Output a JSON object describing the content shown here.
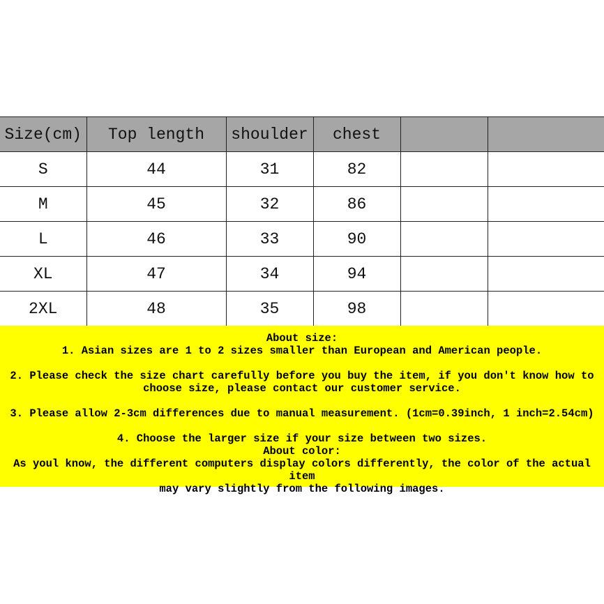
{
  "table": {
    "headers": [
      "Size(cm)",
      "Top length",
      "shoulder",
      "chest",
      "",
      ""
    ],
    "rows": [
      [
        "S",
        "44",
        "31",
        "82",
        "",
        ""
      ],
      [
        "M",
        "45",
        "32",
        "86",
        "",
        ""
      ],
      [
        "L",
        "46",
        "33",
        "90",
        "",
        ""
      ],
      [
        "XL",
        "47",
        "34",
        "94",
        "",
        ""
      ],
      [
        "2XL",
        "48",
        "35",
        "98",
        "",
        ""
      ]
    ]
  },
  "notes": {
    "size_title": "About size:",
    "item1": "1. Asian sizes are 1 to 2 sizes smaller than European and American people.",
    "item2a": "2. Please check the size chart carefully before you buy the item, if you don't know how to",
    "item2b": "choose size, please contact our customer service.",
    "item3": "3. Please allow 2-3cm differences due to manual measurement. (1cm=0.39inch, 1 inch=2.54cm)",
    "item4": "4. Choose the larger size if your size between two sizes.",
    "color_title": "About color:",
    "color_a": "As youl know, the different computers display colors differently, the color of the actual item",
    "color_b": "may vary slightly from the following images."
  },
  "colors": {
    "header_bg": "#a6a6a6",
    "notes_bg": "#ffff00"
  }
}
